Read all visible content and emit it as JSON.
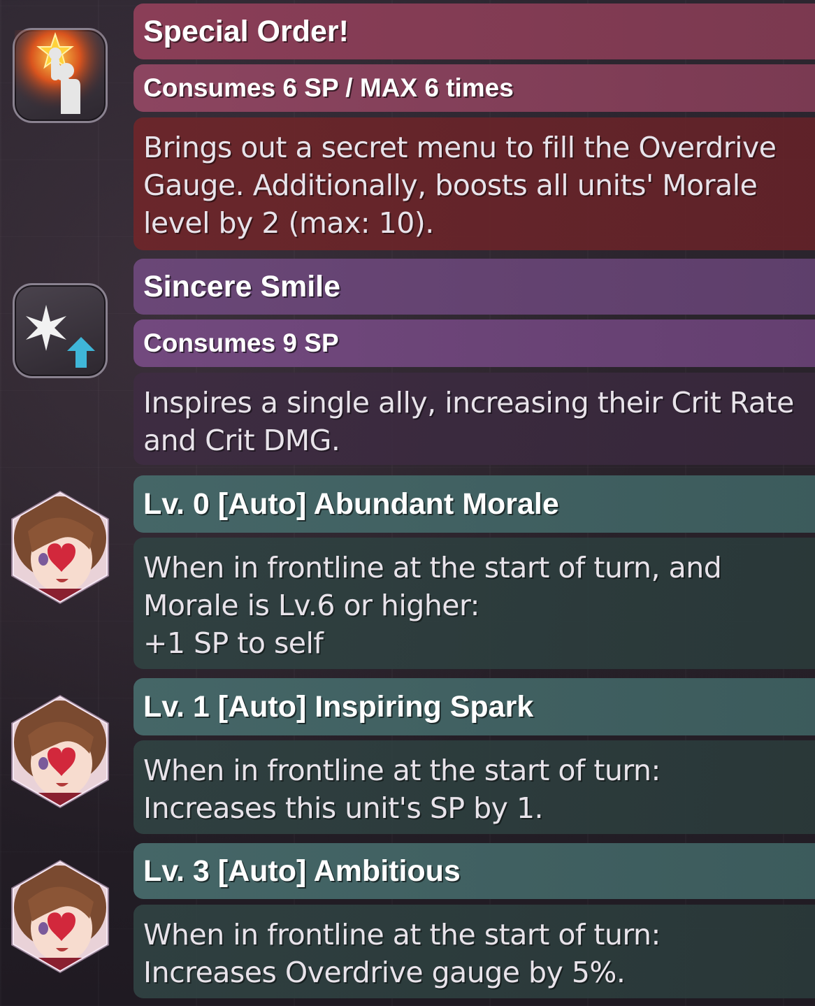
{
  "skills": [
    {
      "title": "Special Order!",
      "cost": "Consumes 6 SP / MAX 6 times",
      "description": "Brings out a secret menu to fill the Overdrive\nGauge. Additionally, boosts all units' Morale\nlevel by 2 (max: 10).",
      "icon": "raised-fist-star-icon"
    },
    {
      "title": "Sincere Smile",
      "cost": "Consumes 9 SP",
      "description": "Inspires a single ally, increasing their Crit Rate\nand Crit DMG.",
      "icon": "starburst-up-arrow-icon"
    }
  ],
  "passives": [
    {
      "title": "Lv. 0 [Auto] Abundant Morale",
      "description": "When in frontline at the start of turn, and\nMorale is Lv.6 or higher:\n+1 SP to self",
      "icon": "character-portrait-icon"
    },
    {
      "title": "Lv. 1 [Auto] Inspiring Spark",
      "description": "When in frontline at the start of turn:\nIncreases this unit's SP by 1.",
      "icon": "character-portrait-icon"
    },
    {
      "title": "Lv. 3 [Auto] Ambitious",
      "description": "When in frontline at the start of turn:\nIncreases Overdrive gauge by 5%.",
      "icon": "character-portrait-icon"
    }
  ]
}
